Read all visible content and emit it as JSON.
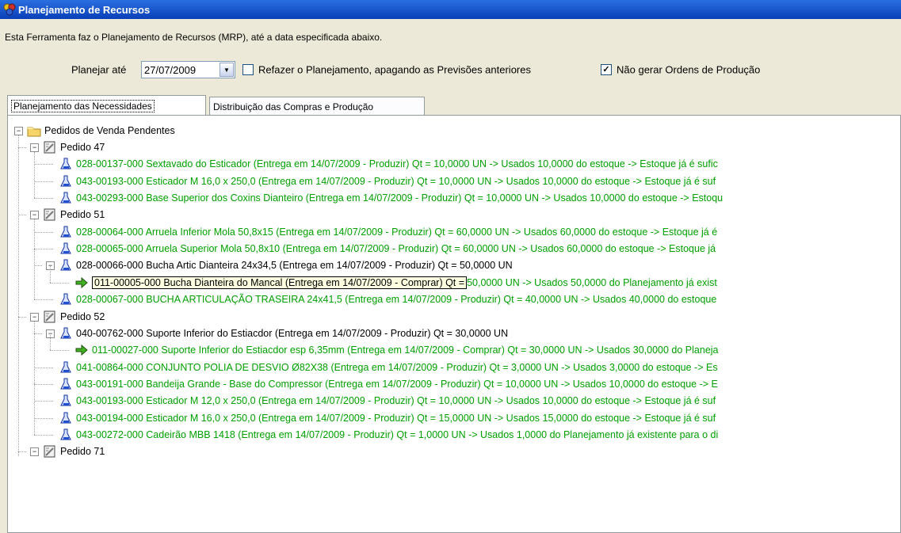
{
  "window": {
    "title": "Planejamento de Recursos"
  },
  "description": "Esta Ferramenta faz o Planejamento de Recursos (MRP), até a data especificada abaixo.",
  "options": {
    "plan_until_label": "Planejar até",
    "plan_until_value": "27/07/2009",
    "redo_label": "Refazer o Planejamento, apagando as Previsões anteriores",
    "redo_checked": false,
    "no_orders_label": "Não gerar Ordens de Produção",
    "no_orders_checked": true
  },
  "tabs": [
    {
      "label": "Planejamento das Necessidades",
      "active": true
    },
    {
      "label": "Distribuição das Compras e Produção",
      "active": false
    }
  ],
  "colors": {
    "green": "#00a000",
    "title_bar": "#0a3fb8",
    "tooltip_bg": "#ffffe1"
  },
  "tree": {
    "root": "Pedidos de Venda Pendentes",
    "orders": [
      {
        "label": "Pedido 47",
        "items": [
          {
            "text": "028-00137-000 Sextavado do Esticador (Entrega em 14/07/2009 - Produzir) Qt = 10,0000 UN -> Usados 10,0000 do estoque -> Estoque já é sufic",
            "green": true
          },
          {
            "text": "043-00193-000 Esticador M 16,0 x 250,0 (Entrega em 14/07/2009 - Produzir) Qt = 10,0000 UN -> Usados 10,0000 do estoque -> Estoque já é suf",
            "green": true
          },
          {
            "text": "043-00293-000 Base Superior dos Coxins Dianteiro (Entrega em 14/07/2009 - Produzir) Qt = 10,0000 UN -> Usados 10,0000 do estoque -> Estoqu",
            "green": true
          }
        ]
      },
      {
        "label": "Pedido 51",
        "items": [
          {
            "text": "028-00064-000 Arruela Inferior Mola 50,8x15 (Entrega em 14/07/2009 - Produzir) Qt = 60,0000 UN -> Usados 60,0000 do estoque -> Estoque já é",
            "green": true
          },
          {
            "text": "028-00065-000 Arruela Superior Mola 50,8x10 (Entrega em 14/07/2009 - Produzir) Qt = 60,0000 UN -> Usados 60,0000 do estoque -> Estoque já",
            "green": true
          },
          {
            "text": "028-00066-000 Bucha Artic Dianteira 24x34,5 (Entrega em 14/07/2009 - Produzir) Qt = 50,0000 UN",
            "green": false
          },
          {
            "tooltip": "011-00005-000 Bucha Dianteira do Mancal (Entrega em 14/07/2009 - Comprar) Qt =",
            "text": "50,0000 UN -> Usados 50,0000 do Planejamento já exist",
            "green": true
          },
          {
            "text": "028-00067-000 BUCHA ARTICULAÇÃO TRASEIRA 24x41,5 (Entrega em 14/07/2009 - Produzir) Qt = 40,0000 UN -> Usados 40,0000 do estoque",
            "green": true
          }
        ]
      },
      {
        "label": "Pedido 52",
        "items": [
          {
            "text": "040-00762-000 Suporte Inferior do Estiacdor (Entrega em 14/07/2009 - Produzir) Qt = 30,0000 UN",
            "green": false
          },
          {
            "text": "011-00027-000 Suporte Inferior do Estiacdor esp 6,35mm (Entrega em 14/07/2009 - Comprar) Qt = 30,0000 UN -> Usados 30,0000 do Planeja",
            "green": true
          },
          {
            "text": "041-00864-000 CONJUNTO POLIA DE DESVIO Ø82X38 (Entrega em 14/07/2009 - Produzir) Qt = 3,0000 UN -> Usados 3,0000 do estoque -> Es",
            "green": true
          },
          {
            "text": "043-00191-000 Bandeija  Grande - Base do Compressor (Entrega em 14/07/2009 - Produzir) Qt = 10,0000 UN -> Usados 10,0000 do estoque -> E",
            "green": true
          },
          {
            "text": "043-00193-000 Esticador M 12,0 x 250,0 (Entrega em 14/07/2009 - Produzir) Qt = 10,0000 UN -> Usados 10,0000 do estoque -> Estoque já é suf",
            "green": true
          },
          {
            "text": "043-00194-000 Esticador M 16,0 x 250,0 (Entrega em 14/07/2009 - Produzir) Qt = 15,0000 UN -> Usados 15,0000 do estoque -> Estoque já é suf",
            "green": true
          },
          {
            "text": "043-00272-000 Cadeirão MBB 1418 (Entrega em 14/07/2009 - Produzir) Qt = 1,0000 UN -> Usados 1,0000 do Planejamento já existente para o di",
            "green": true
          }
        ]
      },
      {
        "label": "Pedido 71",
        "items": []
      }
    ]
  }
}
